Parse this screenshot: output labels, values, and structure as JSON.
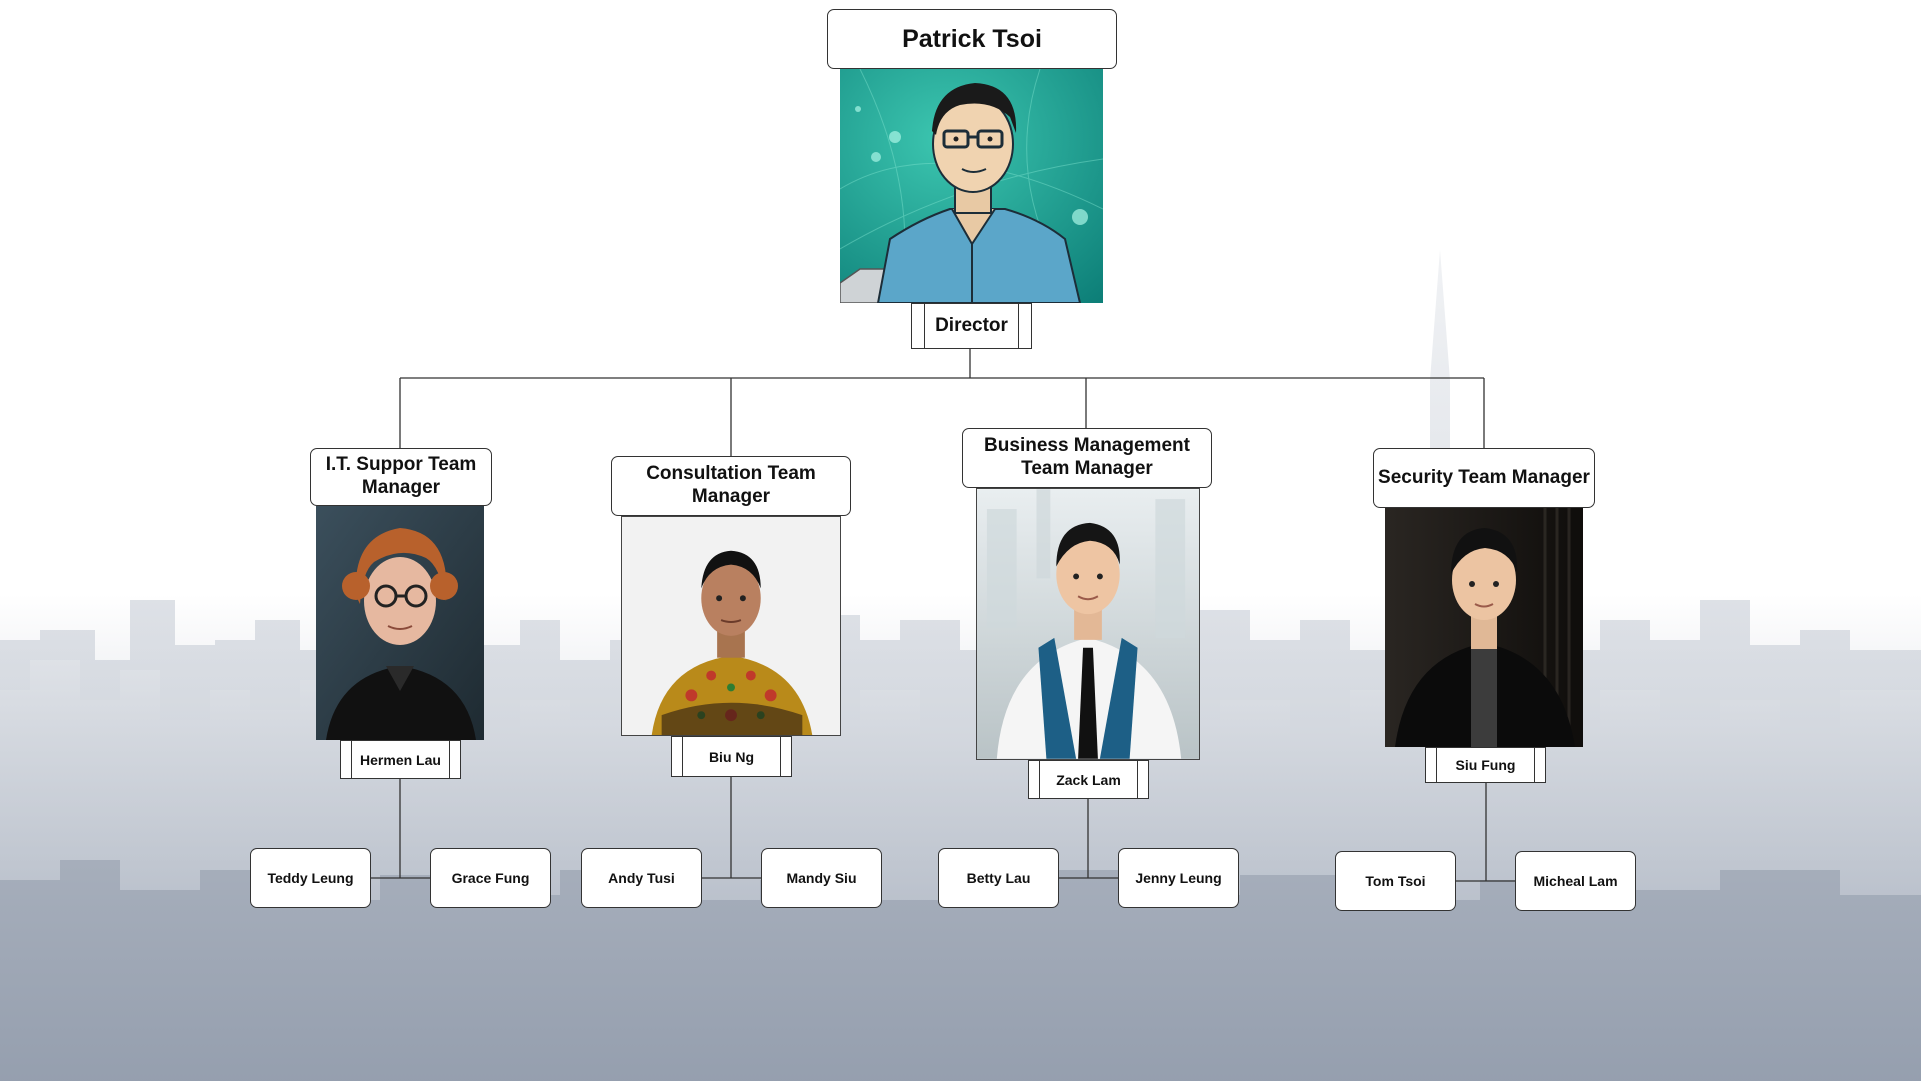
{
  "director": {
    "name": "Patrick Tsoi",
    "title": "Director"
  },
  "managers": [
    {
      "title": "I.T. Suppor Team Manager",
      "name": "Hermen Lau",
      "staff": [
        "Teddy Leung",
        "Grace Fung"
      ]
    },
    {
      "title": "Consultation Team Manager",
      "name": "Biu Ng",
      "staff": [
        "Andy Tusi",
        "Mandy Siu"
      ]
    },
    {
      "title": "Business Management Team Manager",
      "name": "Zack Lam",
      "staff": [
        "Betty Lau",
        "Jenny Leung"
      ]
    },
    {
      "title": "Security Team Manager",
      "name": "Siu Fung",
      "staff": [
        "Tom Tsoi",
        "Micheal Lam"
      ]
    }
  ],
  "colors": {
    "line": "#333333",
    "box_border": "#333333",
    "box_fill": "#ffffff",
    "skyline": "#a9b0bd",
    "director_photo_bg": "#1f9e8f"
  }
}
